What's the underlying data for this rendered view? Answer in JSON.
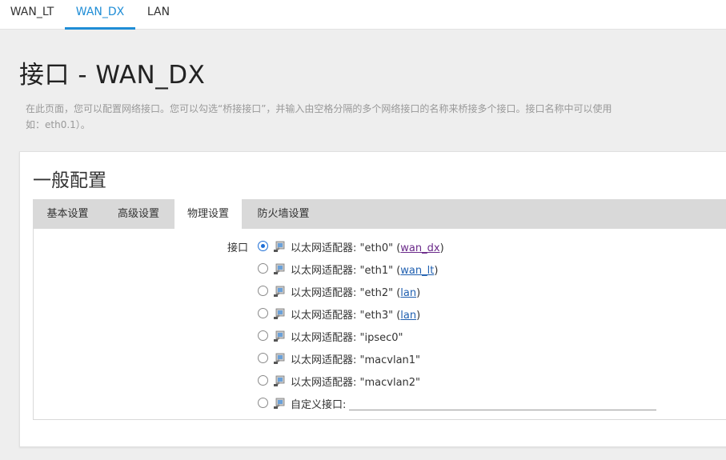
{
  "topnav": {
    "tabs": [
      {
        "label": "WAN_LT"
      },
      {
        "label": "WAN_DX"
      },
      {
        "label": "LAN"
      }
    ]
  },
  "page": {
    "title": "接口 - WAN_DX",
    "description_line1": "在此页面，您可以配置网络接口。您可以勾选“桥接接口”，并输入由空格分隔的多个网络接口的名称来桥接多个接口。接口名称中可以使用",
    "description_line2": "如：eth0.1）。"
  },
  "section": {
    "title": "一般配置",
    "tabs": [
      {
        "label": "基本设置"
      },
      {
        "label": "高级设置"
      },
      {
        "label": "物理设置"
      },
      {
        "label": "防火墙设置"
      }
    ]
  },
  "physical": {
    "field_label": "接口",
    "options": [
      {
        "prefix": "以太网适配器: \"eth0\" (",
        "link": "wan_dx",
        "suffix": ")",
        "checked": true
      },
      {
        "prefix": "以太网适配器: \"eth1\" (",
        "link": "wan_lt",
        "suffix": ")",
        "checked": false
      },
      {
        "prefix": "以太网适配器: \"eth2\" (",
        "link": "lan",
        "suffix": ")",
        "checked": false
      },
      {
        "prefix": "以太网适配器: \"eth3\" (",
        "link": "lan",
        "suffix": ")",
        "checked": false
      },
      {
        "prefix": "以太网适配器: \"ipsec0\"",
        "checked": false
      },
      {
        "prefix": "以太网适配器: \"macvlan1\"",
        "checked": false
      },
      {
        "prefix": "以太网适配器: \"macvlan2\"",
        "checked": false
      },
      {
        "prefix": "自定义接口:",
        "checked": false,
        "custom": true,
        "value": ""
      }
    ]
  },
  "colors": {
    "accent": "#1f8dd6",
    "link": "#1f5fb0",
    "visited_link": "#6b2a8a",
    "tab_bar": "#d9d9d9"
  }
}
